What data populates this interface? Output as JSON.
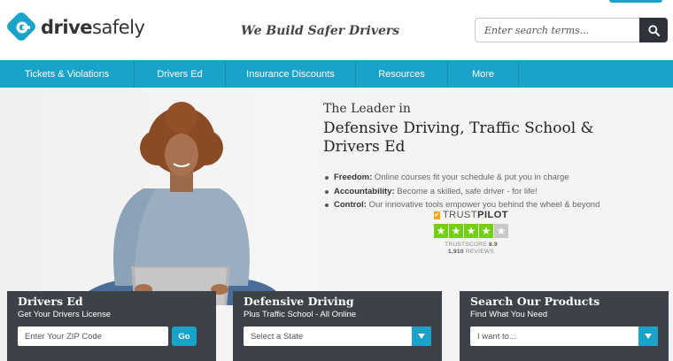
{
  "header": {
    "logo_text_bold": "drive",
    "logo_text_light": "safely",
    "tagline": "We Build Safer Drivers",
    "search": {
      "placeholder": "Enter search terms...",
      "icon": "search-icon"
    }
  },
  "nav": {
    "items": [
      {
        "label": "Tickets & Violations"
      },
      {
        "label": "Drivers Ed"
      },
      {
        "label": "Insurance Discounts"
      },
      {
        "label": "Resources"
      },
      {
        "label": "More"
      }
    ]
  },
  "hero": {
    "kicker": "The Leader in",
    "headline_line1": "Defensive Driving, Traffic School &",
    "headline_line2": "Drivers Ed",
    "bullets": [
      {
        "term": "Freedom:",
        "text": " Online courses fit your schedule & put you in charge"
      },
      {
        "term": "Accountability:",
        "text": " Become a skilled, safe driver - for life!"
      },
      {
        "term": "Control:",
        "text": " Our innovative tools empower you behind the wheel & beyond"
      }
    ]
  },
  "trustpilot": {
    "brand_light": "TRUST",
    "brand_bold": "PILOT",
    "score_label": "TRUSTSCORE",
    "score_value": "8.9",
    "reviews_count": "1,910",
    "reviews_label": "REVIEWS",
    "stars_filled": 4,
    "stars_total": 5,
    "star_color": "#73cf11"
  },
  "panels": {
    "drivers_ed": {
      "title": "Drivers Ed",
      "subtitle": "Get Your Drivers License",
      "zip_placeholder": "Enter Your ZIP Code",
      "go_label": "Go"
    },
    "defensive_driving": {
      "title": "Defensive Driving",
      "subtitle": "Plus Traffic School - All Online",
      "select_value": "Select a State"
    },
    "search_products": {
      "title": "Search Our Products",
      "subtitle": "Find What You Need",
      "select_value": "I want to..."
    }
  },
  "colors": {
    "accent": "#1aa3c8",
    "panel_bg": "#3c4247",
    "search_button": "#2d3338"
  }
}
